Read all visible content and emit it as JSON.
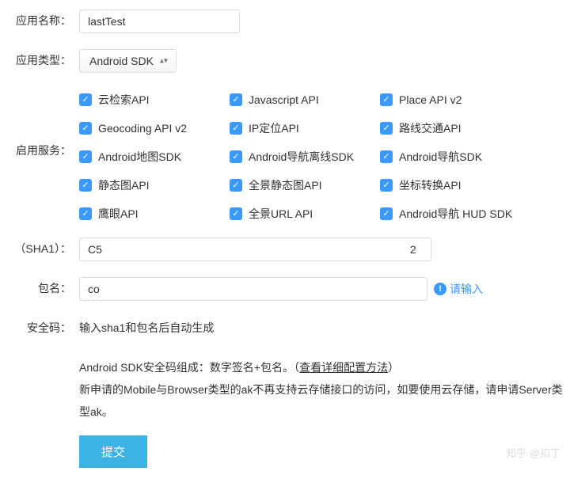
{
  "labels": {
    "app_name": "应用名称：",
    "app_type": "应用类型：",
    "services": "启用服务：",
    "sha1": "（SHA1）：",
    "package": "包名：",
    "security": "安全码："
  },
  "app_name_value": "lastTest",
  "app_type_value": "Android SDK",
  "services": [
    {
      "label": "云检索API"
    },
    {
      "label": "Javascript API"
    },
    {
      "label": "Place API v2"
    },
    {
      "label": "Geocoding API v2"
    },
    {
      "label": "IP定位API"
    },
    {
      "label": "路线交通API"
    },
    {
      "label": "Android地图SDK"
    },
    {
      "label": "Android导航离线SDK"
    },
    {
      "label": "Android导航SDK"
    },
    {
      "label": "静态图API"
    },
    {
      "label": "全景静态图API"
    },
    {
      "label": "坐标转换API"
    },
    {
      "label": "鹰眼API"
    },
    {
      "label": "全景URL API"
    },
    {
      "label": "Android导航 HUD SDK"
    }
  ],
  "sha1_value": "C5                                                                                                    2",
  "package_value": "co",
  "package_hint": "请输入",
  "security_text": "输入sha1和包名后自动生成",
  "desc": {
    "line1_a": "Android SDK安全码组成：数字签名+包名。（",
    "line1_link": "查看详细配置方法",
    "line1_b": "）",
    "line2": "新申请的Mobile与Browser类型的ak不再支持云存储接口的访问，如要使用云存储，请申请Server类型ak。"
  },
  "submit_label": "提交",
  "watermark": "知乎 @扣丁"
}
